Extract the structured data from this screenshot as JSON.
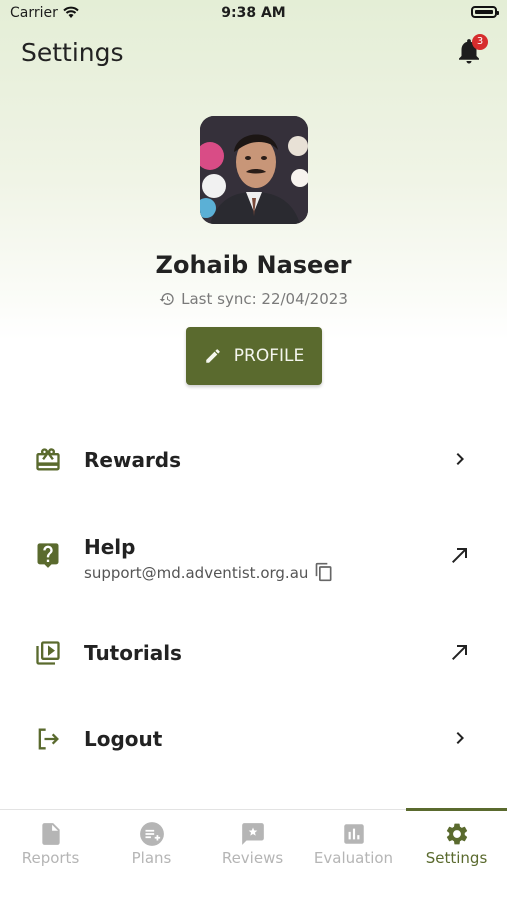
{
  "status_bar": {
    "carrier": "Carrier",
    "time": "9:38 AM"
  },
  "header": {
    "title": "Settings",
    "notification_count": "3"
  },
  "profile": {
    "name": "Zohaib Naseer",
    "last_sync": "Last sync: 22/04/2023",
    "profile_button": "PROFILE"
  },
  "menu": {
    "rewards": {
      "label": "Rewards",
      "icon": "gift-icon",
      "action_icon": "chevron-right-icon"
    },
    "help": {
      "label": "Help",
      "email": "support@md.adventist.org.au",
      "icon": "help-icon",
      "action_icon": "external-arrow-icon"
    },
    "tutorials": {
      "label": "Tutorials",
      "icon": "video-library-icon",
      "action_icon": "external-arrow-icon"
    },
    "logout": {
      "label": "Logout",
      "icon": "logout-icon",
      "action_icon": "chevron-right-icon"
    }
  },
  "tabs": [
    {
      "label": "Reports",
      "icon": "document-icon",
      "active": false
    },
    {
      "label": "Plans",
      "icon": "plans-icon",
      "active": false
    },
    {
      "label": "Reviews",
      "icon": "reviews-icon",
      "active": false
    },
    {
      "label": "Evaluation",
      "icon": "chart-icon",
      "active": false
    },
    {
      "label": "Settings",
      "icon": "gear-icon",
      "active": true
    }
  ],
  "colors": {
    "accent": "#5a6a2e",
    "badge": "#d62d2d",
    "inactive_tab": "#b5b5b5"
  }
}
